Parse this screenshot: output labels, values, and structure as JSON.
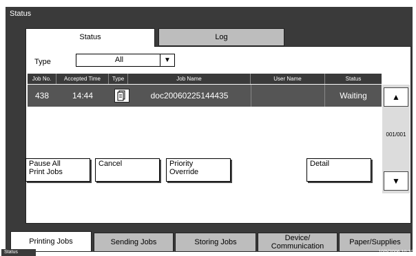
{
  "window": {
    "title": "Status"
  },
  "tabs": [
    {
      "label": "Status"
    },
    {
      "label": "Log"
    }
  ],
  "filter": {
    "label": "Type",
    "value": "All"
  },
  "table": {
    "headers": [
      "Job No.",
      "Accepted Time",
      "Type",
      "Job Name",
      "User Name",
      "Status"
    ],
    "rows": [
      {
        "job_no": "438",
        "accepted_time": "14:44",
        "type_icon": "document-icon",
        "job_name": "doc20060225144435",
        "user_name": "",
        "status": "Waiting"
      }
    ]
  },
  "pager": {
    "indicator": "001/001"
  },
  "buttons": {
    "pause_all": "Pause All\nPrint Jobs",
    "cancel": "Cancel",
    "priority_override": "Priority\nOverride",
    "detail": "Detail"
  },
  "bottom_tabs": [
    "Printing Jobs",
    "Sending Jobs",
    "Storing Jobs",
    "Device/\nCommunication",
    "Paper/Supplies"
  ],
  "statusbar": {
    "label": "Status",
    "datetime": "10/5/2006   10:10"
  }
}
